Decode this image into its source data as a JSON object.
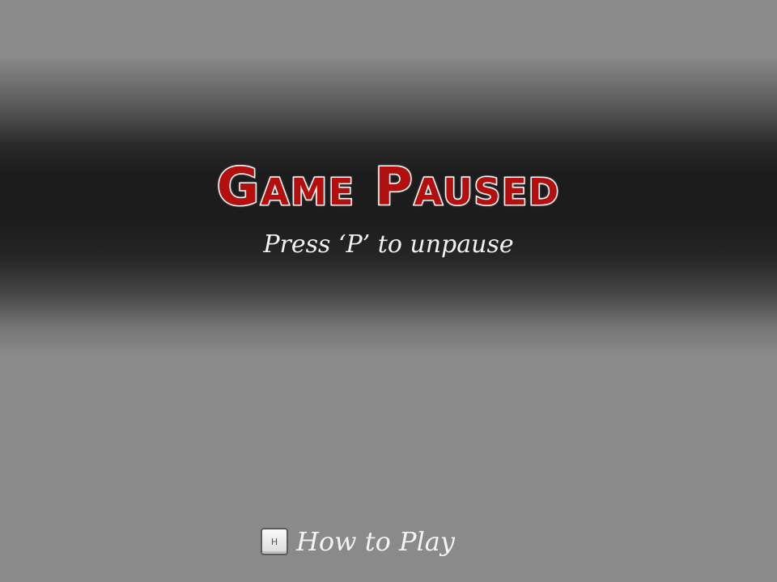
{
  "pause_overlay": {
    "title": "Game Paused",
    "subtitle": "Press ‘P’ to unpause",
    "title_color": "#b30f0f",
    "title_outline_color": "#ffffff"
  },
  "help": {
    "key_label": "H",
    "label": "How to Play"
  }
}
